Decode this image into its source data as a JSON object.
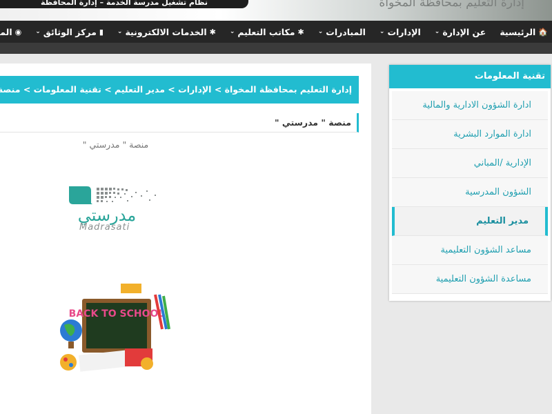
{
  "header": {
    "banner_left": "نظام تشغيل مدرسة الخدمة – إدارة المحافظة",
    "banner_right": "إدارة التعليم بمحافظة المخواة"
  },
  "nav": {
    "items": [
      {
        "label": "الرئيسية",
        "icon": "home-icon",
        "glyph": "🏠",
        "has_caret": false
      },
      {
        "label": "عن الإدارة",
        "icon": "",
        "glyph": "",
        "has_caret": true
      },
      {
        "label": "الإدارات",
        "icon": "",
        "glyph": "",
        "has_caret": true
      },
      {
        "label": "المبادرات",
        "icon": "",
        "glyph": "",
        "has_caret": true
      },
      {
        "label": "مكاتب التعليم",
        "icon": "gear-icon",
        "glyph": "✱",
        "has_caret": true
      },
      {
        "label": "الخدمات الالكترونية",
        "icon": "gear-icon",
        "glyph": "✱",
        "has_caret": true
      },
      {
        "label": "مركز الوثائق",
        "icon": "document-icon",
        "glyph": "▮",
        "has_caret": true
      },
      {
        "label": "المـ",
        "icon": "eye-icon",
        "glyph": "◉",
        "has_caret": false
      }
    ]
  },
  "main": {
    "breadcrumb": "إدارة التعليم بمحافظة المخواة > الإدارات > مدير التعليم > تقنية المعلومات > منصة \" مدرستي \"",
    "section_title": "منصة \" مدرستي \"",
    "subtitle": "منصة \" مدرستي \"",
    "logo_text": "مدرستي",
    "logo_sub": "Madrasati",
    "illustration_text": "BACK TO SCHOOL"
  },
  "sidebar": {
    "title": "تقنية المعلومات",
    "items": [
      {
        "label": "ادارة الشؤون الادارية والمالية",
        "active": false
      },
      {
        "label": "ادارة الموارد البشرية",
        "active": false
      },
      {
        "label": "الإدارية /المباني",
        "active": false
      },
      {
        "label": "الشؤون المدرسية",
        "active": false
      },
      {
        "label": "مدير التعليم",
        "active": true
      },
      {
        "label": "مساعد الشؤون التعليمية",
        "active": false
      },
      {
        "label": "مساعدة الشؤون التعليمية",
        "active": false
      }
    ]
  },
  "colors": {
    "accent": "#22bcd0",
    "nav_bg": "#262626",
    "logo_green": "#2aa59a"
  }
}
